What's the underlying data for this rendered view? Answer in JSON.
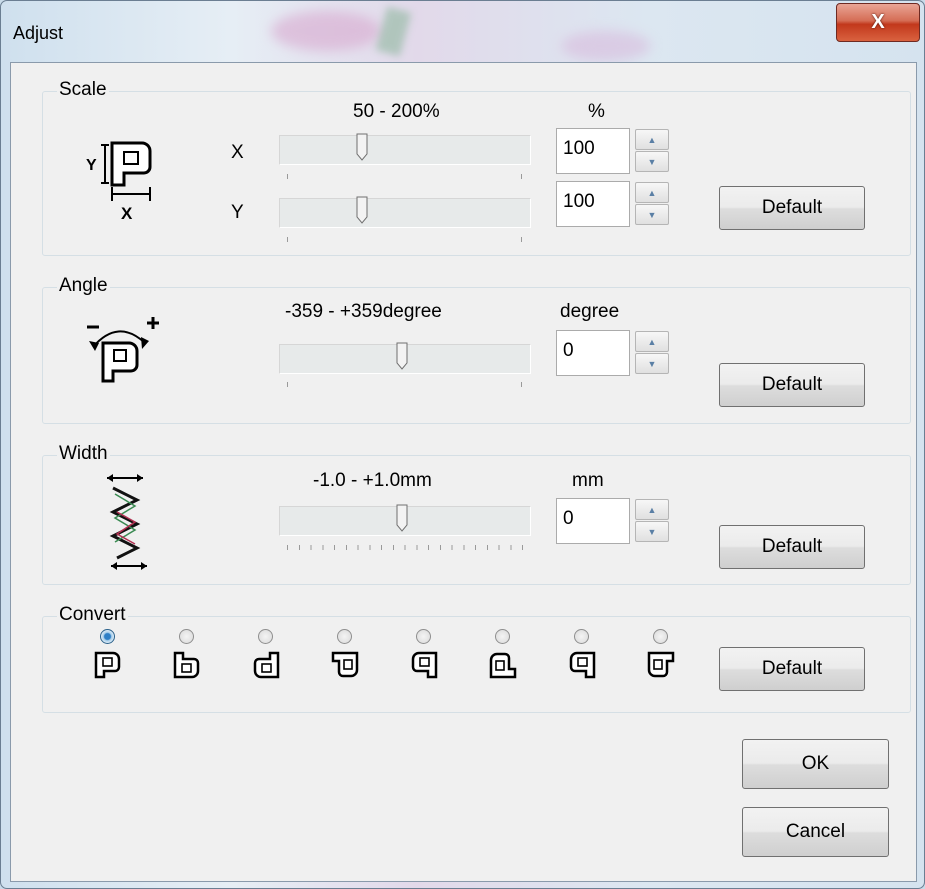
{
  "window": {
    "title": "Adjust",
    "close_glyph": "X"
  },
  "scale": {
    "label": "Scale",
    "range_text": "50 - 200%",
    "unit": "%",
    "x_label": "X",
    "y_label": "Y",
    "x_value": "100",
    "y_value": "100",
    "default_label": "Default"
  },
  "angle": {
    "label": "Angle",
    "range_text": "-359 - +359degree",
    "unit": "degree",
    "value": "0",
    "default_label": "Default"
  },
  "width": {
    "label": "Width",
    "range_text": "-1.0 - +1.0mm",
    "unit": "mm",
    "value": "0",
    "default_label": "Default"
  },
  "convert": {
    "label": "Convert",
    "options": [
      "p-normal",
      "p-flip-vertical",
      "p-rotate-180",
      "p-rotate-90",
      "p-mirror-rotate",
      "p-rotate-270",
      "p-mirror",
      "p-flip-rotate"
    ],
    "selected_index": 0,
    "default_label": "Default"
  },
  "buttons": {
    "ok": "OK",
    "cancel": "Cancel"
  },
  "colors": {
    "close_red": "#c2381c",
    "radio_selected": "#2d7fc6"
  }
}
